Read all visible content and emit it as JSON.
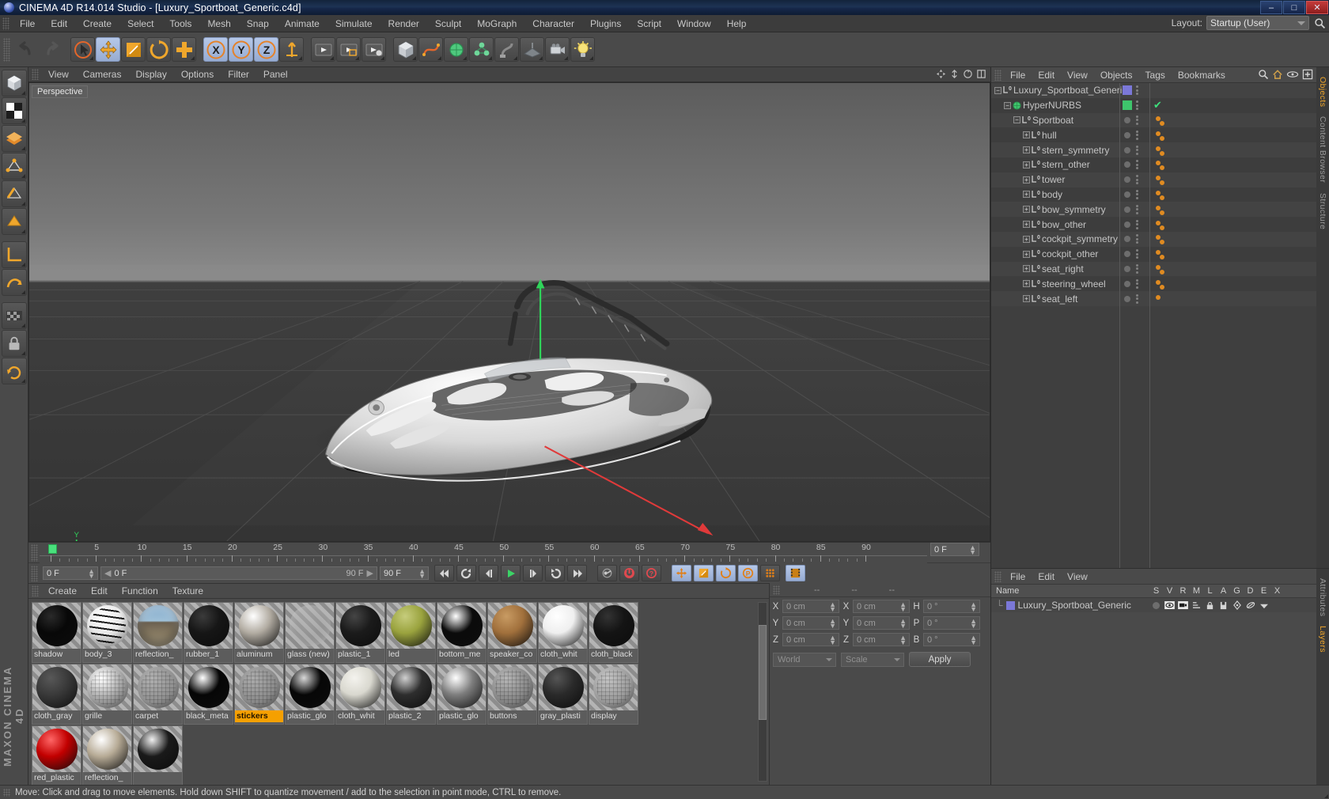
{
  "window": {
    "title": "CINEMA 4D R14.014 Studio - [Luxury_Sportboat_Generic.c4d]",
    "minimize": "–",
    "maximize": "□",
    "close": "✕"
  },
  "menubar": {
    "items": [
      "File",
      "Edit",
      "Create",
      "Select",
      "Tools",
      "Mesh",
      "Snap",
      "Animate",
      "Simulate",
      "Render",
      "Sculpt",
      "MoGraph",
      "Character",
      "Plugins",
      "Script",
      "Window",
      "Help"
    ],
    "layout_label": "Layout:",
    "layout_value": "Startup (User)"
  },
  "toolbar": {
    "buttons": [
      {
        "name": "undo-button",
        "glyph": "↰"
      },
      {
        "name": "redo-button",
        "glyph": "↱"
      },
      {
        "name": "live-selection-tool",
        "glyph": "sel"
      },
      {
        "name": "move-tool",
        "glyph": "move"
      },
      {
        "name": "scale-tool",
        "glyph": "scale"
      },
      {
        "name": "rotate-tool",
        "glyph": "rotate"
      },
      {
        "name": "add-tool",
        "glyph": "plus"
      },
      {
        "name": "x-axis-lock",
        "glyph": "X"
      },
      {
        "name": "y-axis-lock",
        "glyph": "Y"
      },
      {
        "name": "z-axis-lock",
        "glyph": "Z"
      },
      {
        "name": "world-object-axis",
        "glyph": "axis"
      },
      {
        "name": "render-view-button",
        "glyph": "render"
      },
      {
        "name": "render-region-button",
        "glyph": "region"
      },
      {
        "name": "render-settings-button",
        "glyph": "settings"
      },
      {
        "name": "add-cube-button",
        "glyph": "cube"
      },
      {
        "name": "add-spline-button",
        "glyph": "spline"
      },
      {
        "name": "add-hypernurbs-button",
        "glyph": "nurbs"
      },
      {
        "name": "add-array-button",
        "glyph": "array"
      },
      {
        "name": "add-bend-button",
        "glyph": "bend"
      },
      {
        "name": "add-floor-button",
        "glyph": "floor"
      },
      {
        "name": "add-camera-button",
        "glyph": "camera"
      },
      {
        "name": "add-light-button",
        "glyph": "light"
      }
    ]
  },
  "leftbar": {
    "buttons": [
      {
        "name": "model-mode-button",
        "glyph": "model"
      },
      {
        "name": "texture-mode-button",
        "glyph": "texture"
      },
      {
        "name": "polygon-mode-button",
        "glyph": "poly"
      },
      {
        "name": "points-mode-button",
        "glyph": "points"
      },
      {
        "name": "edges-mode-button",
        "glyph": "edges"
      },
      {
        "name": "polygons-mode-button",
        "glyph": "polys"
      },
      {
        "name": "workplane-button",
        "glyph": "plane"
      },
      {
        "name": "enable-axis-button",
        "glyph": "axis"
      },
      {
        "name": "viewport-solo-button",
        "glyph": "solo"
      },
      {
        "name": "lock-button",
        "glyph": "lock"
      },
      {
        "name": "quantize-button",
        "glyph": "quant"
      }
    ],
    "brand": "MAXON CINEMA 4D"
  },
  "viewport": {
    "menu": [
      "View",
      "Cameras",
      "Display",
      "Options",
      "Filter",
      "Panel"
    ],
    "label": "Perspective",
    "scene_description": "Grey studio grid with a luxury sportboat 3D model, green Y axis handle and red Z axis arrow"
  },
  "timeline": {
    "ticks": [
      "0",
      "5",
      "10",
      "15",
      "20",
      "25",
      "30",
      "35",
      "40",
      "45",
      "50",
      "55",
      "60",
      "65",
      "70",
      "75",
      "80",
      "85",
      "90"
    ],
    "current_frame_left": "0 F",
    "current_frame_right": "0 F",
    "range_start": "0 F",
    "range_end": "90 F",
    "end_field": "90 F",
    "playback_buttons": [
      {
        "name": "go-to-start-button",
        "glyph": "⏮"
      },
      {
        "name": "play-reverse-button",
        "glyph": "⟳"
      },
      {
        "name": "step-back-button",
        "glyph": "◀|"
      },
      {
        "name": "play-button",
        "glyph": "▶"
      },
      {
        "name": "step-forward-button",
        "glyph": "|▶"
      },
      {
        "name": "play-forward-loop-button",
        "glyph": "⟲"
      },
      {
        "name": "go-to-end-button",
        "glyph": "⏭"
      },
      {
        "name": "record-active-objects-button",
        "glyph": "key"
      },
      {
        "name": "autokeying-button",
        "glyph": "auto"
      },
      {
        "name": "keyframe-selection-button",
        "glyph": "?"
      },
      {
        "name": "position-key-button",
        "glyph": "pos"
      },
      {
        "name": "scale-key-button",
        "glyph": "scl"
      },
      {
        "name": "rotation-key-button",
        "glyph": "rot"
      },
      {
        "name": "parameter-key-button",
        "glyph": "P"
      },
      {
        "name": "point-level-animation-button",
        "glyph": "pla"
      },
      {
        "name": "timeline-button",
        "glyph": "film"
      }
    ]
  },
  "materials": {
    "menu": [
      "Create",
      "Edit",
      "Function",
      "Texture"
    ],
    "selected": "stickers",
    "items": [
      {
        "name": "shadow",
        "color": "#080808",
        "hl": "#2a2a2a"
      },
      {
        "name": "body_3",
        "color": "#e8e8e8",
        "hl": "#ffffff",
        "striped": true
      },
      {
        "name": "reflection_",
        "color": "#8d7f62",
        "hl": "#dfe7ef",
        "env": true
      },
      {
        "name": "rubber_1",
        "color": "#161616",
        "hl": "#3b3b3b"
      },
      {
        "name": "aluminum",
        "color": "#b2aca2",
        "hl": "#ffffff"
      },
      {
        "name": "glass (new)",
        "color": "#8f8f8f",
        "hl": "#b9b9b9",
        "glass": true
      },
      {
        "name": "plastic_1",
        "color": "#1b1b1b",
        "hl": "#454545"
      },
      {
        "name": "led",
        "color": "#9aa33e",
        "hl": "#c6cc7c"
      },
      {
        "name": "bottom_me",
        "color": "#0b0b0b",
        "hl": "#ffffff"
      },
      {
        "name": "speaker_co",
        "color": "#a1703c",
        "hl": "#c89b63"
      },
      {
        "name": "cloth_whit",
        "color": "#efefef",
        "hl": "#ffffff"
      },
      {
        "name": "cloth_black",
        "color": "#141414",
        "hl": "#333333"
      },
      {
        "name": "cloth_gray",
        "color": "#3a3a3a",
        "hl": "#585858"
      },
      {
        "name": "grille",
        "color": "#9a9a9a",
        "hl": "#ffffff",
        "tex": true
      },
      {
        "name": "carpet",
        "color": "#8f8f8f",
        "hl": "#b0b0b0",
        "tex": true
      },
      {
        "name": "black_meta",
        "color": "#060606",
        "hl": "#ffffff"
      },
      {
        "name": "stickers",
        "color": "#8a8a8a",
        "hl": "#ababab",
        "tex": true
      },
      {
        "name": "plastic_glo",
        "color": "#070707",
        "hl": "#d8d8d8"
      },
      {
        "name": "cloth_whit",
        "color": "#d9d8cf",
        "hl": "#f4f3ee"
      },
      {
        "name": "plastic_2",
        "color": "#2e2e2e",
        "hl": "#d0d0d0"
      },
      {
        "name": "plastic_glo",
        "color": "#7e7e7e",
        "hl": "#ffffff"
      },
      {
        "name": "buttons",
        "color": "#858585",
        "hl": "#b6b6b6",
        "tex": true
      },
      {
        "name": "gray_plasti",
        "color": "#2a2a2a",
        "hl": "#555555"
      },
      {
        "name": "display",
        "color": "#999999",
        "hl": "#c4c4c4",
        "tex": true
      },
      {
        "name": "red_plastic",
        "color": "#c20000",
        "hl": "#ff6666"
      },
      {
        "name": "reflection_",
        "color": "#b7ab96",
        "hl": "#ffffff"
      },
      {
        "name": "",
        "color": "#1a1a1a",
        "hl": "#f0f0f0"
      }
    ]
  },
  "coordinates": {
    "header": [
      "--",
      "--",
      "--"
    ],
    "rows": [
      {
        "a1": "X",
        "v1": "0 cm",
        "a2": "X",
        "v2": "0 cm",
        "a3": "H",
        "v3": "0 °"
      },
      {
        "a1": "Y",
        "v1": "0 cm",
        "a2": "Y",
        "v2": "0 cm",
        "a3": "P",
        "v3": "0 °"
      },
      {
        "a1": "Z",
        "v1": "0 cm",
        "a2": "Z",
        "v2": "0 cm",
        "a3": "B",
        "v3": "0 °"
      }
    ],
    "space": "World",
    "mode": "Scale",
    "apply": "Apply"
  },
  "objects": {
    "menu": [
      "File",
      "Edit",
      "View",
      "Objects",
      "Tags",
      "Bookmarks"
    ],
    "tabs": [
      "Objects",
      "Content Browser",
      "Structure"
    ],
    "active_tab": "Objects",
    "tree": [
      {
        "label": "Luxury_Sportboat_Generic",
        "indent": 0,
        "icon": "null",
        "expander": "−",
        "color": "#7b78d8",
        "tags": 0,
        "check": false
      },
      {
        "label": "HyperNURBS",
        "indent": 1,
        "icon": "nurbs",
        "expander": "−",
        "color": "#3ec46c",
        "tags": 0,
        "check": true
      },
      {
        "label": "Sportboat",
        "indent": 2,
        "icon": "null",
        "expander": "−",
        "tags": 2
      },
      {
        "label": "hull",
        "indent": 3,
        "icon": "null",
        "expander": "+",
        "tags": 2
      },
      {
        "label": "stern_symmetry",
        "indent": 3,
        "icon": "null",
        "expander": "+",
        "tags": 2
      },
      {
        "label": "stern_other",
        "indent": 3,
        "icon": "null",
        "expander": "+",
        "tags": 2
      },
      {
        "label": "tower",
        "indent": 3,
        "icon": "null",
        "expander": "+",
        "tags": 2
      },
      {
        "label": "body",
        "indent": 3,
        "icon": "null",
        "expander": "+",
        "tags": 2
      },
      {
        "label": "bow_symmetry",
        "indent": 3,
        "icon": "null",
        "expander": "+",
        "tags": 2
      },
      {
        "label": "bow_other",
        "indent": 3,
        "icon": "null",
        "expander": "+",
        "tags": 2
      },
      {
        "label": "cockpit_symmetry",
        "indent": 3,
        "icon": "null",
        "expander": "+",
        "tags": 2
      },
      {
        "label": "cockpit_other",
        "indent": 3,
        "icon": "null",
        "expander": "+",
        "tags": 2
      },
      {
        "label": "seat_right",
        "indent": 3,
        "icon": "null",
        "expander": "+",
        "tags": 2
      },
      {
        "label": "steering_wheel",
        "indent": 3,
        "icon": "null",
        "expander": "+",
        "tags": 2
      },
      {
        "label": "seat_left",
        "indent": 3,
        "icon": "null",
        "expander": "+",
        "tags": 1
      }
    ]
  },
  "attributes": {
    "menu": [
      "File",
      "Edit",
      "View"
    ],
    "columns": [
      "Name",
      "S",
      "V",
      "R",
      "M",
      "L",
      "A",
      "G",
      "D",
      "E",
      "X"
    ],
    "rows": [
      {
        "name": "Luxury_Sportboat_Generic",
        "color": "#7b78d8"
      }
    ],
    "tabs": [
      "Attributes",
      "Layers"
    ]
  },
  "statusbar": {
    "message": "Move: Click and drag to move elements. Hold down SHIFT to quantize movement / add to the selection in point mode, CTRL to remove."
  },
  "colors": {
    "accent_orange": "#f0a72c",
    "selection_blue": "#a8bcdf",
    "tag_orange": "#e08b21",
    "panel_bg": "#4a4a4a",
    "nurbs_green": "#3ec46c"
  }
}
